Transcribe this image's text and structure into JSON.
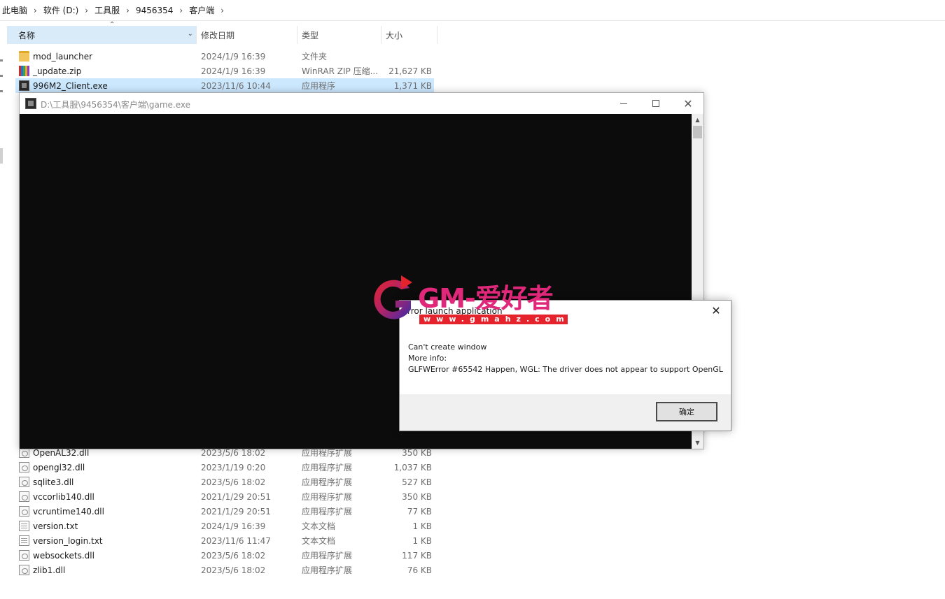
{
  "breadcrumb": [
    "此电脑",
    "软件 (D:)",
    "工具服",
    "9456354",
    "客户端"
  ],
  "columns": {
    "name": "名称",
    "date": "修改日期",
    "type": "类型",
    "size": "大小"
  },
  "files_top": [
    {
      "name": "mod_launcher",
      "date": "2024/1/9 16:39",
      "type": "文件夹",
      "size": "",
      "icon": "folder-icon"
    },
    {
      "name": "_update.zip",
      "date": "2024/1/9 16:39",
      "type": "WinRAR ZIP 压缩...",
      "size": "21,627 KB",
      "icon": "zip-archive-icon"
    },
    {
      "name": "996M2_Client.exe",
      "date": "2023/11/6 10:44",
      "type": "应用程序",
      "size": "1,371 KB",
      "icon": "exe-icon",
      "selected": true
    }
  ],
  "files_bottom": [
    {
      "name": "OpenAL32.dll",
      "date": "2023/5/6 18:02",
      "type": "应用程序扩展",
      "size": "350 KB",
      "icon": "dll-icon"
    },
    {
      "name": "opengl32.dll",
      "date": "2023/1/19 0:20",
      "type": "应用程序扩展",
      "size": "1,037 KB",
      "icon": "dll-icon"
    },
    {
      "name": "sqlite3.dll",
      "date": "2023/5/6 18:02",
      "type": "应用程序扩展",
      "size": "527 KB",
      "icon": "dll-icon"
    },
    {
      "name": "vccorlib140.dll",
      "date": "2021/1/29 20:51",
      "type": "应用程序扩展",
      "size": "350 KB",
      "icon": "dll-icon"
    },
    {
      "name": "vcruntime140.dll",
      "date": "2021/1/29 20:51",
      "type": "应用程序扩展",
      "size": "77 KB",
      "icon": "dll-icon"
    },
    {
      "name": "version.txt",
      "date": "2024/1/9 16:39",
      "type": "文本文档",
      "size": "1 KB",
      "icon": "text-file-icon"
    },
    {
      "name": "version_login.txt",
      "date": "2023/11/6 11:47",
      "type": "文本文档",
      "size": "1 KB",
      "icon": "text-file-icon"
    },
    {
      "name": "websockets.dll",
      "date": "2023/5/6 18:02",
      "type": "应用程序扩展",
      "size": "117 KB",
      "icon": "dll-icon"
    },
    {
      "name": "zlib1.dll",
      "date": "2023/5/6 18:02",
      "type": "应用程序扩展",
      "size": "76 KB",
      "icon": "dll-icon"
    }
  ],
  "console": {
    "title": "D:\\工具服\\9456354\\客户端\\game.exe"
  },
  "dialog": {
    "title": "rror launch application",
    "line1": "Can't create window",
    "line2": "More info:",
    "line3": "GLFWError #65542 Happen, WGL: The driver does not appear to support OpenGL",
    "ok_label": "确定"
  },
  "watermark": {
    "text": "GM-爱好者",
    "url": "www.gmahz.com"
  },
  "colors": {
    "accent_selected": "#cce8ff",
    "header_selected": "#d9ebf9",
    "console_bg": "#0c0c0c",
    "watermark_pink": "#e0287a",
    "watermark_red": "#e4232d"
  }
}
